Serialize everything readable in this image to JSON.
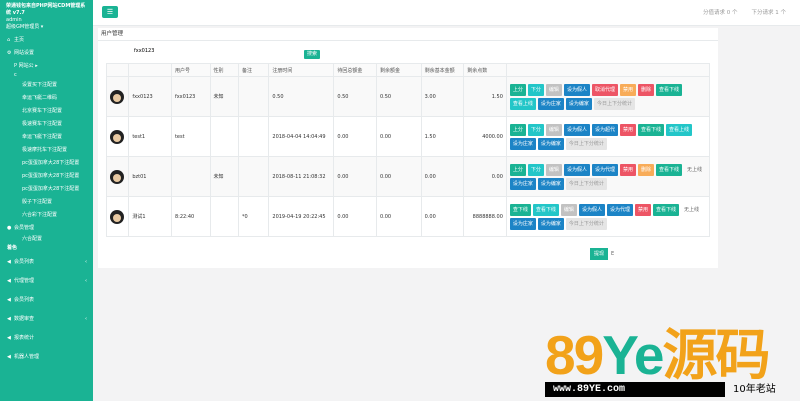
{
  "sidebar": {
    "title": "荣通钱包来自PHP网站CDM管理系统 v7.7",
    "user": "admin",
    "role": "超级GM管理员 ▾",
    "home": "主页",
    "site_section": "网站设置",
    "lottery": "P 网站公 ▸",
    "lottery_sub": "c",
    "subitems": [
      "设置买下注配置",
      "幸运飞艇二维码",
      "北京赛车下注配置",
      "极速赛车下注配置",
      "幸运飞艇下注配置",
      "极速摩托车下注配置",
      "pc蛋蛋加拿大28下注配置",
      "pc蛋蛋加拿大28下注配置",
      "pc蛋蛋加拿大28下注配置",
      "骰子下注配置",
      "六合彩下注配置"
    ],
    "member_mgmt": "会员管理",
    "member_sub": "六合配置",
    "dot_label": "着色",
    "menu": [
      {
        "label": "会员列表",
        "arrow": "‹"
      },
      {
        "label": "代理管理",
        "arrow": "‹"
      },
      {
        "label": "会员列表",
        "arrow": ""
      },
      {
        "label": "数据审查",
        "arrow": "‹"
      },
      {
        "label": "报表统计",
        "arrow": ""
      },
      {
        "label": "机器人管理",
        "arrow": ""
      }
    ]
  },
  "topbar": {
    "menu_icon": "☰",
    "right": [
      "分值请求 0 个",
      "下分请求 1 个"
    ]
  },
  "content": {
    "title": "用户管理",
    "search_value": "fxx0123",
    "search_btn": "搜索",
    "pager": {
      "current": "提现",
      "next": "E"
    }
  },
  "table": {
    "headers": [
      "",
      "",
      "用户号",
      "性别",
      "备注",
      "注册时间",
      "待回总额金",
      "剩余额金",
      "剩余基本金额",
      "剩余点数",
      ""
    ],
    "rows": [
      {
        "name": "fxx0123",
        "uid": "fxx0123",
        "gender": "未知",
        "note": "",
        "time": "0.50",
        "c1": "0.50",
        "c2": "0.50",
        "c3": "3.00",
        "c4": "1.50",
        "btns": [
          [
            "上分",
            "g"
          ],
          [
            "下分",
            "c"
          ],
          [
            "编辑",
            "gr"
          ],
          [
            "设为假人",
            "bl"
          ],
          [
            "取消代理",
            "r"
          ],
          [
            "禁用",
            "o"
          ],
          [
            "删除",
            "r"
          ],
          [
            "查看下线",
            "g"
          ],
          [
            "查看上线",
            "c"
          ],
          [
            "设为庄家",
            "bl"
          ],
          [
            "设为编家",
            "bl"
          ],
          [
            "今日上下分统计",
            "gh"
          ]
        ]
      },
      {
        "name": "test1",
        "uid": "test",
        "gender": "",
        "note": "",
        "time": "2018-04-04 14:04:49",
        "c1": "0.00",
        "c2": "0.00",
        "c3": "1.50",
        "c4": "4000.00",
        "btns": [
          [
            "上分",
            "g"
          ],
          [
            "下分",
            "c"
          ],
          [
            "编辑",
            "gr"
          ],
          [
            "设为假人",
            "bl"
          ],
          [
            "设为超代",
            "bl"
          ],
          [
            "禁用",
            "r"
          ],
          [
            "查看下线",
            "g"
          ],
          [
            "查看上线",
            "c"
          ],
          [
            "设为庄家",
            "bl"
          ],
          [
            "设为编家",
            "bl"
          ],
          [
            "今日上下分统计",
            "gh"
          ]
        ]
      },
      {
        "name": "bzt01",
        "uid": "",
        "gender": "未知",
        "note": "",
        "time": "2018-08-11 21:08:32",
        "c1": "0.00",
        "c2": "0.00",
        "c3": "0.00",
        "c4": "0.00",
        "btns": [
          [
            "上分",
            "g"
          ],
          [
            "下分",
            "c"
          ],
          [
            "编辑",
            "gr"
          ],
          [
            "设为假人",
            "bl"
          ],
          [
            "设为代理",
            "bl"
          ],
          [
            "禁用",
            "r"
          ],
          [
            "删除",
            "o"
          ],
          [
            "查看下线",
            "g"
          ],
          [
            "无上线",
            "t"
          ],
          [
            "设为庄家",
            "bl"
          ],
          [
            "设为编家",
            "bl"
          ],
          [
            "今日上下分统计",
            "gh"
          ]
        ]
      },
      {
        "name": "测试1",
        "uid": "8:22:40",
        "gender": "",
        "note": "*0",
        "time": "2019-04-19 20:22:45",
        "c1": "0.00",
        "c2": "0.00",
        "c3": "0.00",
        "c4": "8888888.00",
        "btns": [
          [
            "查下线",
            "g"
          ],
          [
            "查看下线",
            "c"
          ],
          [
            "编辑",
            "gr"
          ],
          [
            "设为假人",
            "bl"
          ],
          [
            "设为代理",
            "bl"
          ],
          [
            "禁用",
            "r"
          ],
          [
            "查看下线",
            "g"
          ],
          [
            "无上线",
            "t"
          ],
          [
            "设为庄家",
            "bl"
          ],
          [
            "设为编家",
            "bl"
          ],
          [
            "今日上下分统计",
            "gh"
          ]
        ]
      }
    ]
  },
  "watermark": {
    "nums": "89",
    "ye": "Ye",
    "cn": "源码",
    "url": "www.89YE.com",
    "slogan": "10年老站"
  }
}
